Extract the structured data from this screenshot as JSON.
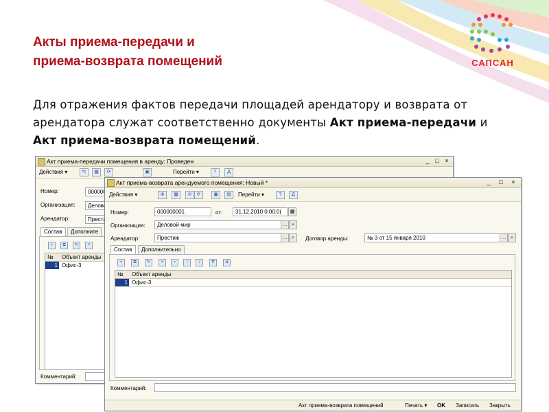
{
  "slide": {
    "title_line1": "Акты приема-передачи и",
    "title_line2": "приема-возврата помещений",
    "para_pre": "Для отражения фактов передачи площадей арендатору и возврата от арендатора служат соответственно документы ",
    "para_bold1": "Акт приема-передачи",
    "para_mid": " и ",
    "para_bold2": "Акт приема-возврата помещений",
    "para_end": "."
  },
  "logo": {
    "text": "САПСАН",
    "color": "#e61f33"
  },
  "colors": {
    "title": "#b0121b",
    "selection": "#1d3f8c"
  },
  "win1": {
    "title": "Акт приема-передачи помещения в аренду: Проведен",
    "actions": "Действия ▾",
    "goto": "Перейти ▾",
    "number_label": "Номер:",
    "number_value": "000000",
    "org_label": "Организация:",
    "org_value": "Делово",
    "tenant_label": "Арендатор:",
    "tenant_value": "Престиж",
    "tab1": "Состав",
    "tab2": "Дополните",
    "col_no": "№",
    "col_obj": "Объект аренды",
    "row_no": "1",
    "row_obj": "Офис-3",
    "comment_label": "Комментарий:"
  },
  "win2": {
    "title": "Акт приема-возврата арендуемого помещения: Новый *",
    "actions": "Действия ▾",
    "goto": "Перейти ▾",
    "number_label": "Номер:",
    "number_value": "000000001",
    "from_label": "от:",
    "date_value": "31.12.2010 0:00:0(",
    "org_label": "Организация:",
    "org_value": "Деловой мир",
    "tenant_label": "Арендатор:",
    "tenant_value": "Престиж",
    "contract_label": "Договор аренды:",
    "contract_value": "№ 3 от 15 января 2010",
    "tab1": "Состав",
    "tab2": "Дополнительно",
    "col_no": "№",
    "col_obj": "Объект аренды",
    "row_no": "1",
    "row_obj": "Офис-3",
    "comment_label": "Комментарий:",
    "status_doc": "Акт приема-возврата помещений",
    "print": "Печать ▾",
    "ok": "OK",
    "save": "Записать",
    "close": "Закрыть"
  }
}
